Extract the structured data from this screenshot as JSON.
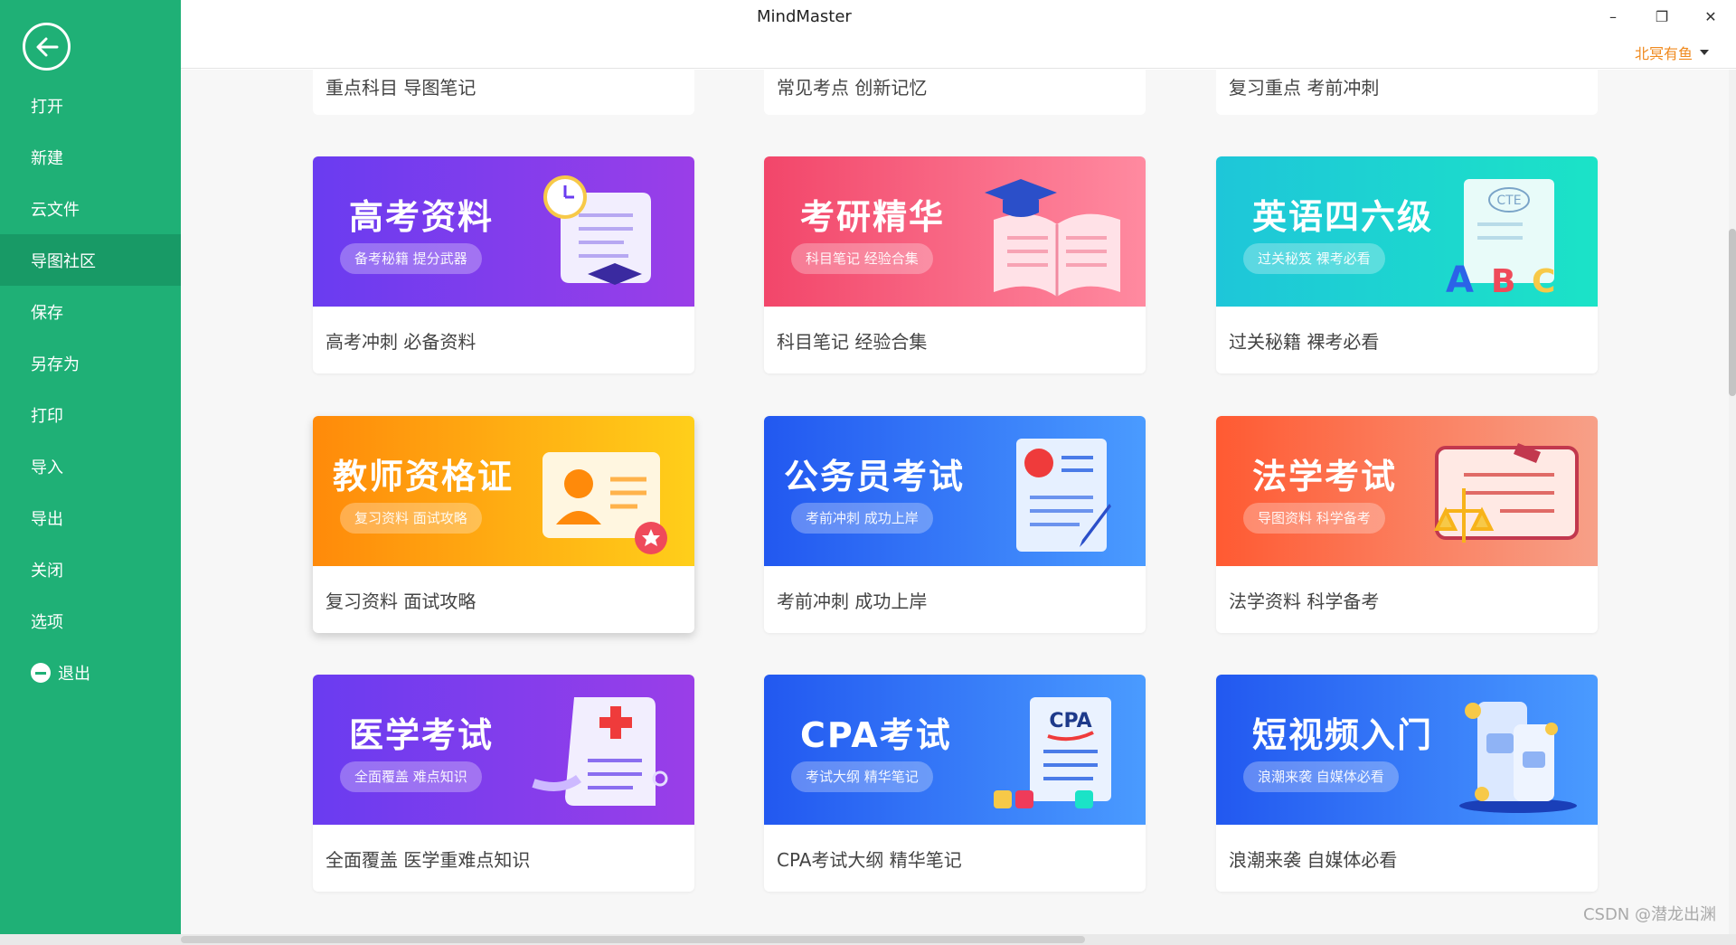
{
  "window": {
    "title": "MindMaster",
    "minimize": "–",
    "restore": "❐",
    "close": "✕",
    "user_name": "北冥有鱼"
  },
  "sidebar": {
    "items": [
      {
        "label": "打开"
      },
      {
        "label": "新建"
      },
      {
        "label": "云文件"
      },
      {
        "label": "导图社区"
      },
      {
        "label": "保存"
      },
      {
        "label": "另存为"
      },
      {
        "label": "打印"
      },
      {
        "label": "导入"
      },
      {
        "label": "导出"
      },
      {
        "label": "关闭"
      },
      {
        "label": "选项"
      },
      {
        "label": "退出"
      }
    ]
  },
  "top_row": [
    {
      "caption": "重点科目 导图笔记"
    },
    {
      "caption": "常见考点 创新记忆"
    },
    {
      "caption": "复习重点 考前冲刺"
    }
  ],
  "cards": [
    {
      "title": "高考资料",
      "tag": "备考秘籍 提分武器",
      "caption": "高考冲刺 必备资料",
      "color_from": "#6a3cf0",
      "color_to": "#9a3ee8"
    },
    {
      "title": "考研精华",
      "tag": "科目笔记 经验合集",
      "caption": "科目笔记 经验合集",
      "color_from": "#f2466a",
      "color_to": "#ff8aa0"
    },
    {
      "title": "英语四六级",
      "tag": "过关秘笈 裸考必看",
      "caption": "过关秘籍 裸考必看",
      "color_from": "#1ec6d9",
      "color_to": "#1be3c7",
      "art_text": "CTE"
    },
    {
      "title": "教师资格证",
      "tag": "复习资料 面试攻略",
      "caption": "复习资料 面试攻略",
      "color_from": "#ff8a0a",
      "color_to": "#ffcf1a"
    },
    {
      "title": "公务员考试",
      "tag": "考前冲刺 成功上岸",
      "caption": "考前冲刺 成功上岸",
      "color_from": "#2258f0",
      "color_to": "#4a9bff"
    },
    {
      "title": "法学考试",
      "tag": "导图资料 科学备考",
      "caption": "法学资料 科学备考",
      "color_from": "#ff5a32",
      "color_to": "#f7a088"
    },
    {
      "title": "医学考试",
      "tag": "全面覆盖 难点知识",
      "caption": "全面覆盖 医学重难点知识",
      "color_from": "#6a3cf0",
      "color_to": "#9a3ee8"
    },
    {
      "title": "CPA考试",
      "tag": "考试大纲 精华笔记",
      "caption": "CPA考试大纲 精华笔记",
      "color_from": "#2258f0",
      "color_to": "#4a9bff",
      "art_text": "CPA"
    },
    {
      "title": "短视频入门",
      "tag": "浪潮来袭 自媒体必看",
      "caption": "浪潮来袭 自媒体必看",
      "color_from": "#2258f0",
      "color_to": "#4a9bff"
    }
  ],
  "watermark": "CSDN @潜龙出渊"
}
